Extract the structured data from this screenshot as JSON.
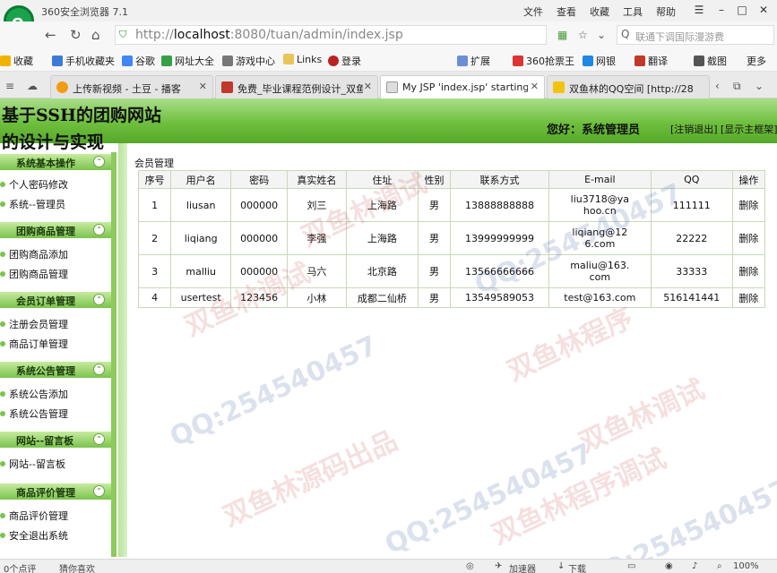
{
  "browser": {
    "app_title": "360安全浏览器 7.1",
    "menu": [
      "文件",
      "查看",
      "收藏",
      "工具",
      "帮助"
    ],
    "url_prefix": "http://",
    "url_host": "localhost",
    "url_rest": ":8080/tuan/admin/index.jsp",
    "search_placeholder": "联通下调国际漫游费",
    "bookmarks": [
      "收藏",
      "手机收藏夹",
      "谷歌",
      "网址大全",
      "游戏中心",
      "Links",
      "登录"
    ],
    "toolbar_right": [
      "扩展",
      "360抢票王",
      "网银",
      "翻译",
      "截图",
      "更多"
    ],
    "tabs": [
      {
        "label": "上传新视频 - 土豆 - 播客"
      },
      {
        "label": "免费_毕业课程范例设计_双鱼"
      },
      {
        "label": "My JSP 'index.jsp' starting"
      },
      {
        "label": "双鱼林的QQ空间 [http://28"
      }
    ]
  },
  "header": {
    "title_line1": "基于SSH的团购网站",
    "title_line2": "的设计与实现",
    "welcome": "您好：系统管理员",
    "logout_link": "[注销退出]",
    "main_frame_link": "[显示主框架]"
  },
  "sidebar": {
    "groups": [
      {
        "title": "系统基本操作",
        "items": [
          "个人密码修改",
          "系统--管理员"
        ]
      },
      {
        "title": "团购商品管理",
        "items": [
          "团购商品添加",
          "团购商品管理"
        ]
      },
      {
        "title": "会员订单管理",
        "items": [
          "注册会员管理",
          "商品订单管理"
        ]
      },
      {
        "title": "系统公告管理",
        "items": [
          "系统公告添加",
          "系统公告管理"
        ]
      },
      {
        "title": "网站--留言板",
        "items": [
          "网站--留言板"
        ]
      },
      {
        "title": "商品评价管理",
        "items": [
          "商品评价管理",
          "安全退出系统"
        ]
      }
    ]
  },
  "main": {
    "heading": "会员管理",
    "columns": [
      "序号",
      "用户名",
      "密码",
      "真实姓名",
      "住址",
      "性别",
      "联系方式",
      "E-mail",
      "QQ",
      "操作"
    ],
    "rows": [
      [
        "1",
        "liusan",
        "000000",
        "刘三",
        "上海路",
        "男",
        "13888888888",
        "liu3718@yahoo.cn",
        "111111",
        "删除"
      ],
      [
        "2",
        "liqiang",
        "000000",
        "李强",
        "上海路",
        "男",
        "13999999999",
        "liqiang@126.com",
        "22222",
        "删除"
      ],
      [
        "3",
        "malliu",
        "000000",
        "马六",
        "北京路",
        "男",
        "13566666666",
        "maliu@163.com",
        "33333",
        "删除"
      ],
      [
        "4",
        "usertest",
        "123456",
        "小林",
        "成都二仙桥",
        "男",
        "13549589053",
        "test@163.com",
        "516141441",
        "删除"
      ]
    ]
  },
  "watermarks": [
    "双鱼林调试",
    "QQ:254540457",
    "双鱼林程序",
    "QQ:254540457",
    "双鱼林源码出品",
    "双鱼林调试",
    "QQ:254540457",
    "双鱼林程序调试",
    "双鱼林调试",
    "QQ:254540457"
  ],
  "statusbar": {
    "left1": "0个点评",
    "left2": "猜你喜欢",
    "accel": "加速器",
    "download": "下载",
    "zoom": "100%"
  },
  "colors": {
    "banner_green": "#6fbf3e",
    "sidebar_header": "#7cc34e"
  }
}
